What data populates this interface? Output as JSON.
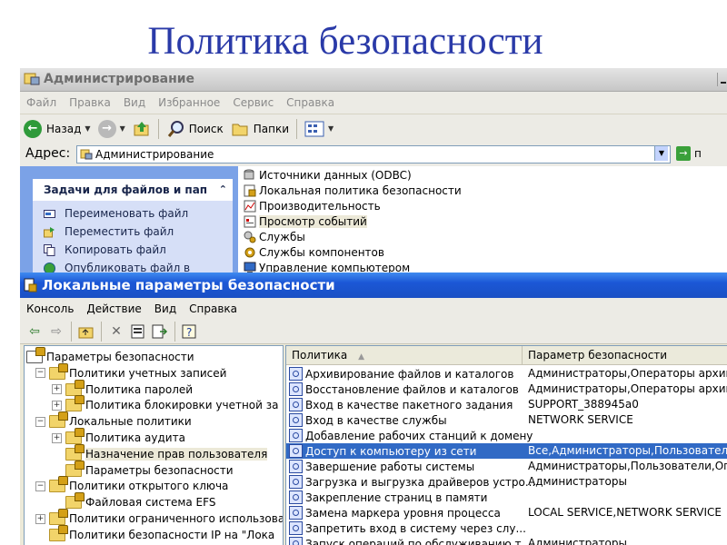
{
  "slide": {
    "title": "Политика безопасности"
  },
  "explorer": {
    "title": "Администрирование",
    "menu": [
      "Файл",
      "Правка",
      "Вид",
      "Избранное",
      "Сервис",
      "Справка"
    ],
    "toolbar": {
      "back": "Назад",
      "search": "Поиск",
      "folders": "Папки"
    },
    "address": {
      "label": "Адрес:",
      "value": "Администрирование",
      "go": "п"
    },
    "tasks": {
      "header": "Задачи для файлов и пап",
      "items": [
        "Переименовать файл",
        "Переместить файл",
        "Копировать файл",
        "Опубликовать файл в"
      ]
    },
    "items": [
      {
        "label": "Источники данных (ODBC)",
        "icon": "odbc-icon"
      },
      {
        "label": "Локальная политика безопасности",
        "icon": "security-policy-icon"
      },
      {
        "label": "Производительность",
        "icon": "performance-icon"
      },
      {
        "label": "Просмотр событий",
        "icon": "event-viewer-icon",
        "highlighted": true
      },
      {
        "label": "Службы",
        "icon": "services-icon"
      },
      {
        "label": "Службы компонентов",
        "icon": "component-services-icon"
      },
      {
        "label": "Управление компьютером",
        "icon": "computer-management-icon"
      }
    ]
  },
  "mmc": {
    "title": "Локальные параметры безопасности",
    "menu": [
      "Консоль",
      "Действие",
      "Вид",
      "Справка"
    ],
    "tree": [
      {
        "label": "Параметры безопасности",
        "level": 0,
        "expander": ""
      },
      {
        "label": "Политики учетных записей",
        "level": 1,
        "expander": "−"
      },
      {
        "label": "Политика паролей",
        "level": 2,
        "expander": "+"
      },
      {
        "label": "Политика блокировки учетной за",
        "level": 2,
        "expander": "+"
      },
      {
        "label": "Локальные политики",
        "level": 1,
        "expander": "−"
      },
      {
        "label": "Политика аудита",
        "level": 2,
        "expander": "+"
      },
      {
        "label": "Назначение прав пользователя",
        "level": 2,
        "expander": "",
        "selected": true
      },
      {
        "label": "Параметры безопасности",
        "level": 2,
        "expander": ""
      },
      {
        "label": "Политики открытого ключа",
        "level": 1,
        "expander": "−"
      },
      {
        "label": "Файловая система EFS",
        "level": 2,
        "expander": ""
      },
      {
        "label": "Политики ограниченного использова",
        "level": 1,
        "expander": "+"
      },
      {
        "label": "Политики безопасности IP на \"Лока",
        "level": 1,
        "expander": ""
      }
    ],
    "columns": {
      "policy": "Политика",
      "setting": "Параметр безопасности"
    },
    "rows": [
      {
        "policy": "Архивирование файлов и каталогов",
        "setting": "Администраторы,Операторы архива"
      },
      {
        "policy": "Восстановление файлов и каталогов",
        "setting": "Администраторы,Операторы архива"
      },
      {
        "policy": "Вход в качестве пакетного задания",
        "setting": "SUPPORT_388945a0"
      },
      {
        "policy": "Вход в качестве службы",
        "setting": "NETWORK SERVICE"
      },
      {
        "policy": "Добавление рабочих станций к домену",
        "setting": ""
      },
      {
        "policy": "Доступ к компьютеру из сети",
        "setting": "Все,Администраторы,Пользователи,(",
        "selected": true
      },
      {
        "policy": "Завершение работы системы",
        "setting": "Администраторы,Пользователи,Опыт"
      },
      {
        "policy": "Загрузка и выгрузка драйверов устро...",
        "setting": "Администраторы"
      },
      {
        "policy": "Закрепление страниц в памяти",
        "setting": ""
      },
      {
        "policy": "Замена маркера уровня процесса",
        "setting": "LOCAL SERVICE,NETWORK SERVICE"
      },
      {
        "policy": "Запретить вход в систему через слу...",
        "setting": ""
      },
      {
        "policy": "Запуск операций по обслуживанию т...",
        "setting": "Администраторы"
      }
    ]
  }
}
